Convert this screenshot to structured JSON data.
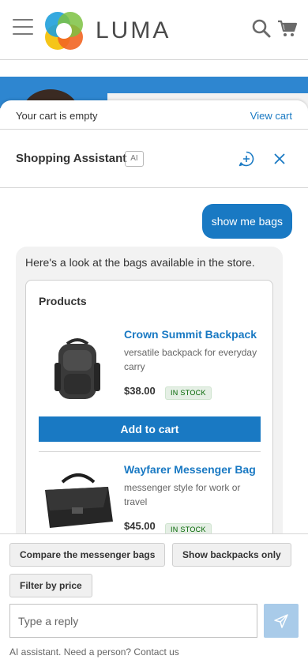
{
  "header": {
    "logo_text": "LUMA",
    "menu_icon": "hamburger-icon",
    "search_icon": "search-icon",
    "cart_icon": "cart-icon"
  },
  "cart_bar": {
    "status": "Your cart is empty",
    "view_cart_label": "View cart"
  },
  "assistant": {
    "title": "Shopping Assistant",
    "badge": "AI",
    "new_chat_icon": "plus-circle-icon",
    "close_icon": "close-icon"
  },
  "chat": {
    "user_message": "show me bags",
    "bot_message": "Here's a look at the bags available in the store.",
    "products_title": "Products",
    "products": [
      {
        "name": "Crown Summit Backpack",
        "description": "versatile backpack for everyday carry",
        "price": "$38.00",
        "stock": "IN STOCK",
        "add_label": "Add to cart"
      },
      {
        "name": "Wayfarer Messenger Bag",
        "description": "messenger style for work or travel",
        "price": "$45.00",
        "stock": "IN STOCK"
      }
    ]
  },
  "composer": {
    "suggestions": [
      "Compare the messenger bags",
      "Show backpacks only",
      "Filter by price"
    ],
    "placeholder": "Type a reply",
    "send_icon": "send-icon",
    "footer": "AI assistant. Need a person? Contact us"
  },
  "colors": {
    "brand_blue": "#1979c3",
    "send_disabled": "#a9cbe9",
    "stock_green": "#006400"
  }
}
